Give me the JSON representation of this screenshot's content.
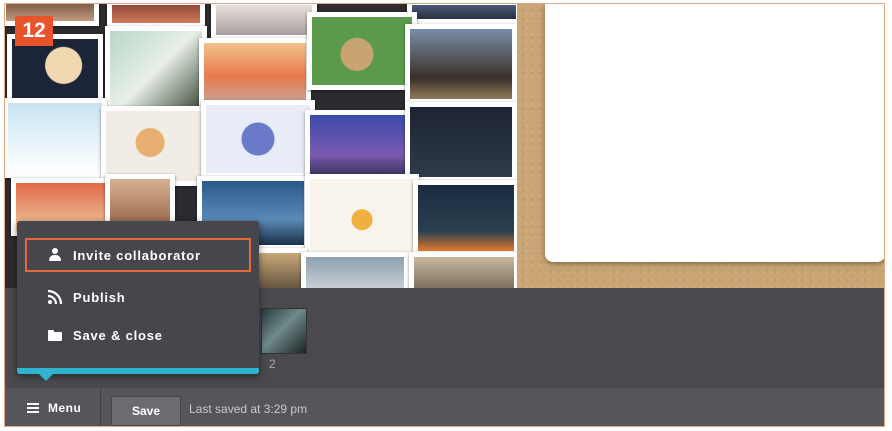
{
  "step_badge": "12",
  "popup_menu": {
    "items": [
      {
        "label": "Invite collaborator",
        "icon": "user-icon",
        "highlighted": true
      },
      {
        "label": "Publish",
        "icon": "rss-icon",
        "highlighted": false
      },
      {
        "label": "Save & close",
        "icon": "folder-icon",
        "highlighted": false
      }
    ]
  },
  "filmstrip": {
    "page_number": "2"
  },
  "bottom_bar": {
    "menu_label": "Menu",
    "save_label": "Save",
    "last_saved": "Last saved at 3:29 pm"
  },
  "colors": {
    "accent": "#2fb3ce",
    "highlight_border": "#e8663a",
    "badge": "#e8532b"
  }
}
